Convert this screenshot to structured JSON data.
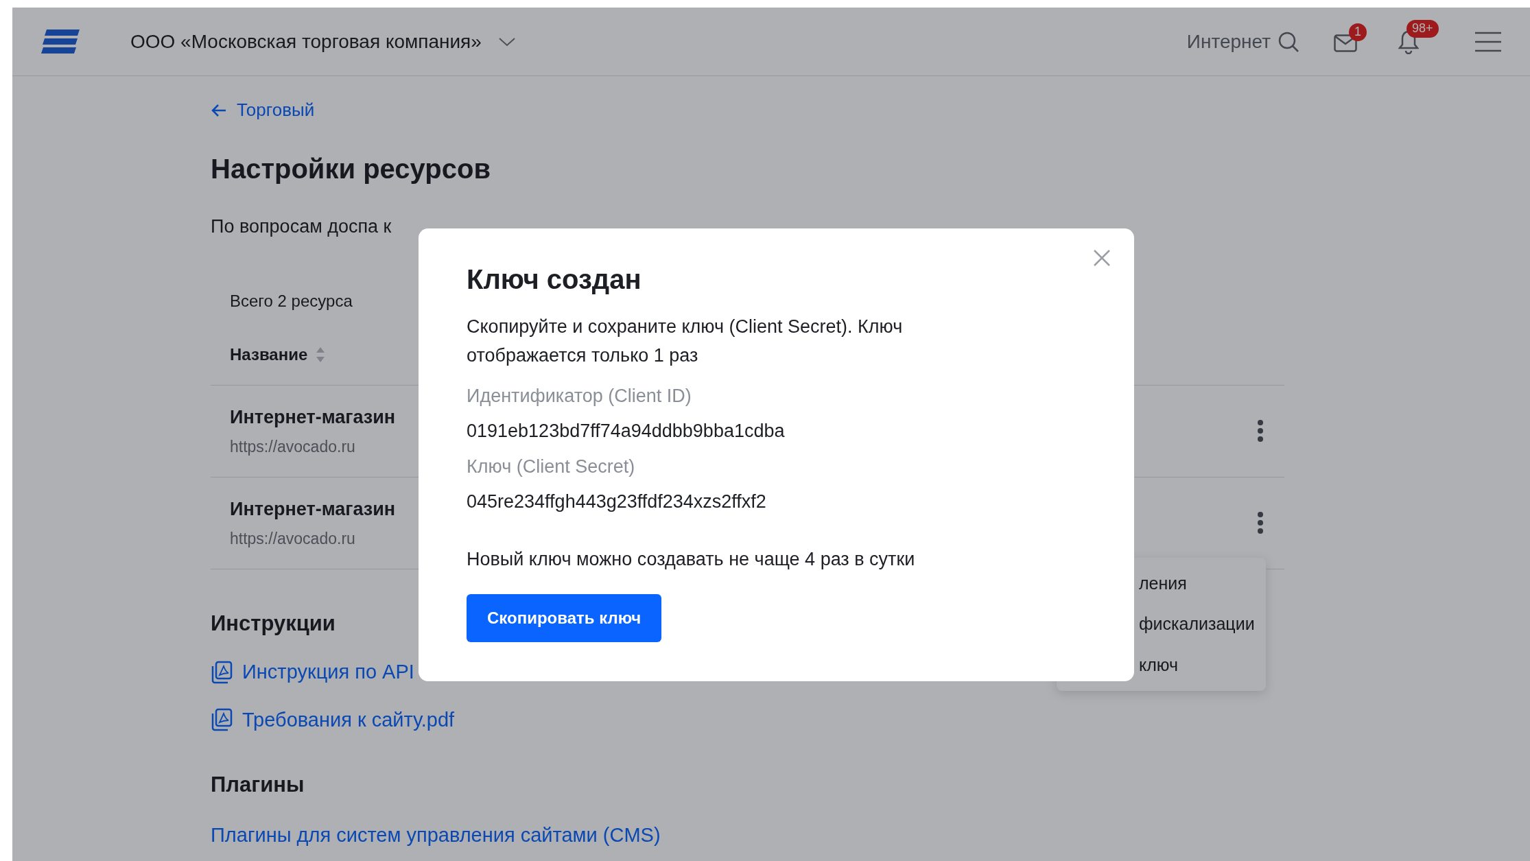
{
  "header": {
    "company": "ООО «Московская торговая компания»",
    "search_label": "Интернет",
    "mail_badge": "1",
    "bell_badge": "98+"
  },
  "page": {
    "back_link": "Торговый",
    "title": "Настройки ресурсов",
    "info_text": "По вопросам доспа к",
    "resources": {
      "total": "Всего 2 ресурса",
      "column": "Название",
      "rows": [
        {
          "name": "Интернет-магазин",
          "url": "https://avocado.ru"
        },
        {
          "name": "Интернет-магазин",
          "url": "https://avocado.ru"
        }
      ],
      "menu_items": [
        "ления",
        "фискализации",
        "ключ"
      ]
    },
    "instructions": {
      "heading": "Инструкции",
      "files": [
        "Инструкция по API",
        "Требования к сайту.pdf"
      ]
    },
    "plugins": {
      "heading": "Плагины",
      "link": "Плагины для систем управления сайтами (CMS)"
    }
  },
  "modal": {
    "title": "Ключ создан",
    "message": "Скопируйте и сохраните ключ (Client Secret). Ключ отображается только 1 раз",
    "fields": [
      {
        "label": "Идентификатор (Client ID)",
        "value": "0191eb123bd7ff74a94ddbb9bba1cdba"
      },
      {
        "label": "Ключ (Client Secret)",
        "value": "045re234ffgh443g23ffdf234xzs2ffxf2"
      }
    ],
    "note": "Новый ключ можно создавать не чаще 4 раз в сутки",
    "button": "Скопировать ключ"
  }
}
